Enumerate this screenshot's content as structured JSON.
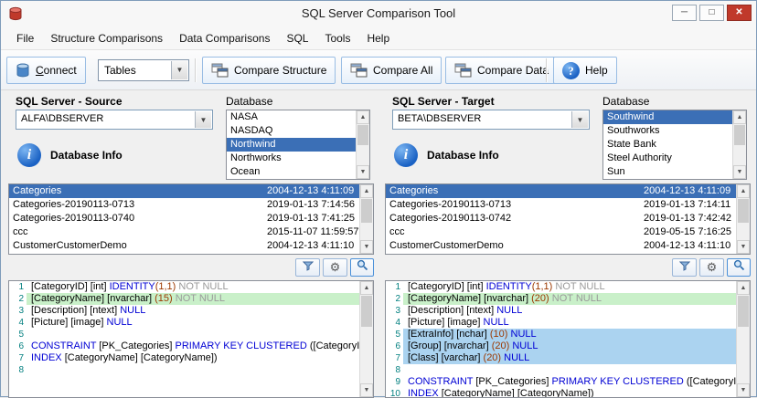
{
  "window": {
    "title": "SQL Server Comparison Tool",
    "controls": {
      "minimize": "─",
      "maximize": "□",
      "close": "✕"
    }
  },
  "menu": {
    "items": [
      "File",
      "Structure Comparisons",
      "Data Comparisons",
      "SQL",
      "Tools",
      "Help"
    ]
  },
  "toolbar": {
    "connect_label": "Connect",
    "object_type_value": "Tables",
    "compare_structure_label": "Compare Structure",
    "compare_all_label": "Compare All",
    "compare_data_label": "Compare Data",
    "help_label": "Help",
    "icons": [
      "database-icon",
      "dropdown-arrow-icon",
      "compare-windows-icon",
      "help-icon"
    ]
  },
  "colors": {
    "selection": "#3b6fb6",
    "green_hl": "#c9f0c9",
    "blue_hl": "#abd3f0",
    "keyword": "#0000d4",
    "number": "#9c3800",
    "muted": "#9a9a9a",
    "linenum": "#007f7f"
  },
  "source": {
    "header": "SQL Server - Source",
    "server": "ALFA\\DBSERVER",
    "database_label": "Database",
    "databases": [
      "NASA",
      "NASDAQ",
      "Northwind",
      "Northworks",
      "Ocean"
    ],
    "selected_database_index": 2,
    "database_info_label": "Database Info",
    "tables": [
      {
        "name": "Categories",
        "modified": "2004-12-13 4:11:09",
        "selected": true
      },
      {
        "name": "Categories-20190113-0713",
        "modified": "2019-01-13 7:14:56",
        "selected": false
      },
      {
        "name": "Categories-20190113-0740",
        "modified": "2019-01-13 7:41:25",
        "selected": false
      },
      {
        "name": "ccc",
        "modified": "2015-11-07 11:59:57",
        "selected": false
      },
      {
        "name": "CustomerCustomerDemo",
        "modified": "2004-12-13 4:11:10",
        "selected": false
      }
    ],
    "sql_lines": [
      {
        "n": 1,
        "hl": "none",
        "tokens": [
          [
            "[CategoryID] [int] ",
            "id"
          ],
          [
            "IDENTITY",
            "kw"
          ],
          [
            "(1,1)",
            "num"
          ],
          [
            " ",
            "id"
          ],
          [
            "NOT NULL",
            "cm"
          ]
        ]
      },
      {
        "n": 2,
        "hl": "green",
        "tokens": [
          [
            "[CategoryName] [nvarchar] ",
            "id"
          ],
          [
            "(15)",
            "num"
          ],
          [
            " ",
            "id"
          ],
          [
            "NOT NULL",
            "cm"
          ]
        ]
      },
      {
        "n": 3,
        "hl": "none",
        "tokens": [
          [
            "[Description] [ntext] ",
            "id"
          ],
          [
            "NULL",
            "kw"
          ]
        ]
      },
      {
        "n": 4,
        "hl": "none",
        "tokens": [
          [
            "[Picture] [image] ",
            "id"
          ],
          [
            "NULL",
            "kw"
          ]
        ]
      },
      {
        "n": 5,
        "hl": "none",
        "tokens": []
      },
      {
        "n": 6,
        "hl": "none",
        "tokens": [
          [
            "CONSTRAINT ",
            "kw"
          ],
          [
            "[PK_Categories] ",
            "id"
          ],
          [
            "PRIMARY KEY CLUSTERED ",
            "kw"
          ],
          [
            "([CategoryID",
            "id"
          ]
        ]
      },
      {
        "n": 7,
        "hl": "none",
        "tokens": [
          [
            "INDEX ",
            "kw"
          ],
          [
            "[CategoryName] [CategoryName])",
            "id"
          ]
        ]
      },
      {
        "n": 8,
        "hl": "none",
        "tokens": []
      }
    ]
  },
  "target": {
    "header": "SQL Server - Target",
    "server": "BETA\\DBSERVER",
    "database_label": "Database",
    "databases": [
      "Southwind",
      "Southworks",
      "State Bank",
      "Steel Authority",
      "Sun"
    ],
    "selected_database_index": 0,
    "database_info_label": "Database Info",
    "tables": [
      {
        "name": "Categories",
        "modified": "2004-12-13 4:11:09",
        "selected": true
      },
      {
        "name": "Categories-20190113-0713",
        "modified": "2019-01-13 7:14:11",
        "selected": false
      },
      {
        "name": "Categories-20190113-0742",
        "modified": "2019-01-13 7:42:42",
        "selected": false
      },
      {
        "name": "ccc",
        "modified": "2019-05-15 7:16:25",
        "selected": false
      },
      {
        "name": "CustomerCustomerDemo",
        "modified": "2004-12-13 4:11:10",
        "selected": false
      }
    ],
    "sql_lines": [
      {
        "n": 1,
        "hl": "none",
        "tokens": [
          [
            "[CategoryID] [int] ",
            "id"
          ],
          [
            "IDENTITY",
            "kw"
          ],
          [
            "(1,1)",
            "num"
          ],
          [
            " ",
            "id"
          ],
          [
            "NOT NULL",
            "cm"
          ]
        ]
      },
      {
        "n": 2,
        "hl": "green",
        "tokens": [
          [
            "[CategoryName] [nvarchar] ",
            "id"
          ],
          [
            "(20)",
            "num"
          ],
          [
            " ",
            "id"
          ],
          [
            "NOT NULL",
            "cm"
          ]
        ]
      },
      {
        "n": 3,
        "hl": "none",
        "tokens": [
          [
            "[Description] [ntext] ",
            "id"
          ],
          [
            "NULL",
            "kw"
          ]
        ]
      },
      {
        "n": 4,
        "hl": "none",
        "tokens": [
          [
            "[Picture] [image] ",
            "id"
          ],
          [
            "NULL",
            "kw"
          ]
        ]
      },
      {
        "n": 5,
        "hl": "blue",
        "tokens": [
          [
            "[ExtraInfo] [nchar] ",
            "id"
          ],
          [
            "(10)",
            "num"
          ],
          [
            " ",
            "id"
          ],
          [
            "NULL",
            "kw"
          ]
        ]
      },
      {
        "n": 6,
        "hl": "blue",
        "tokens": [
          [
            "[Group] [nvarchar] ",
            "id"
          ],
          [
            "(20)",
            "num"
          ],
          [
            " ",
            "id"
          ],
          [
            "NULL",
            "kw"
          ]
        ]
      },
      {
        "n": 7,
        "hl": "blue",
        "tokens": [
          [
            "[Class] [varchar] ",
            "id"
          ],
          [
            "(20)",
            "num"
          ],
          [
            " ",
            "id"
          ],
          [
            "NULL",
            "kw"
          ]
        ]
      },
      {
        "n": 8,
        "hl": "none",
        "tokens": []
      },
      {
        "n": 9,
        "hl": "none",
        "tokens": [
          [
            "CONSTRAINT ",
            "kw"
          ],
          [
            "[PK_Categories] ",
            "id"
          ],
          [
            "PRIMARY KEY CLUSTERED ",
            "kw"
          ],
          [
            "([CategoryI",
            "id"
          ]
        ]
      },
      {
        "n": 10,
        "hl": "none",
        "tokens": [
          [
            "INDEX ",
            "kw"
          ],
          [
            "[CategoryName] [CategoryName])",
            "id"
          ]
        ]
      }
    ]
  }
}
